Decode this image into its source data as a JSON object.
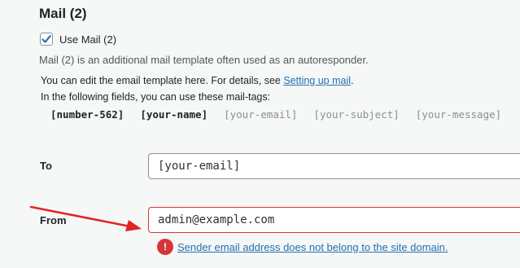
{
  "section": {
    "title": "Mail (2)"
  },
  "use_mail": {
    "label": "Use Mail (2)",
    "checked": true
  },
  "description": "Mail (2) is an additional mail template often used as an autoresponder.",
  "info": {
    "edit_prefix": "You can edit the email template here. For details, see ",
    "edit_link": "Setting up mail",
    "edit_suffix": ".",
    "tags_intro": "In the following fields, you can use these mail-tags:"
  },
  "mail_tags": {
    "used": [
      "[number-562]",
      "[your-name]"
    ],
    "unused": [
      "[your-email]",
      "[your-subject]",
      "[your-message]"
    ]
  },
  "fields": {
    "to": {
      "label": "To",
      "value": "[your-email]"
    },
    "from": {
      "label": "From",
      "value": "admin@example.com"
    }
  },
  "error": {
    "icon": "!",
    "message": "Sender email address does not belong to the site domain."
  },
  "colors": {
    "accent": "#2271b1",
    "error": "#d63638",
    "annotation_arrow": "#e02424"
  }
}
